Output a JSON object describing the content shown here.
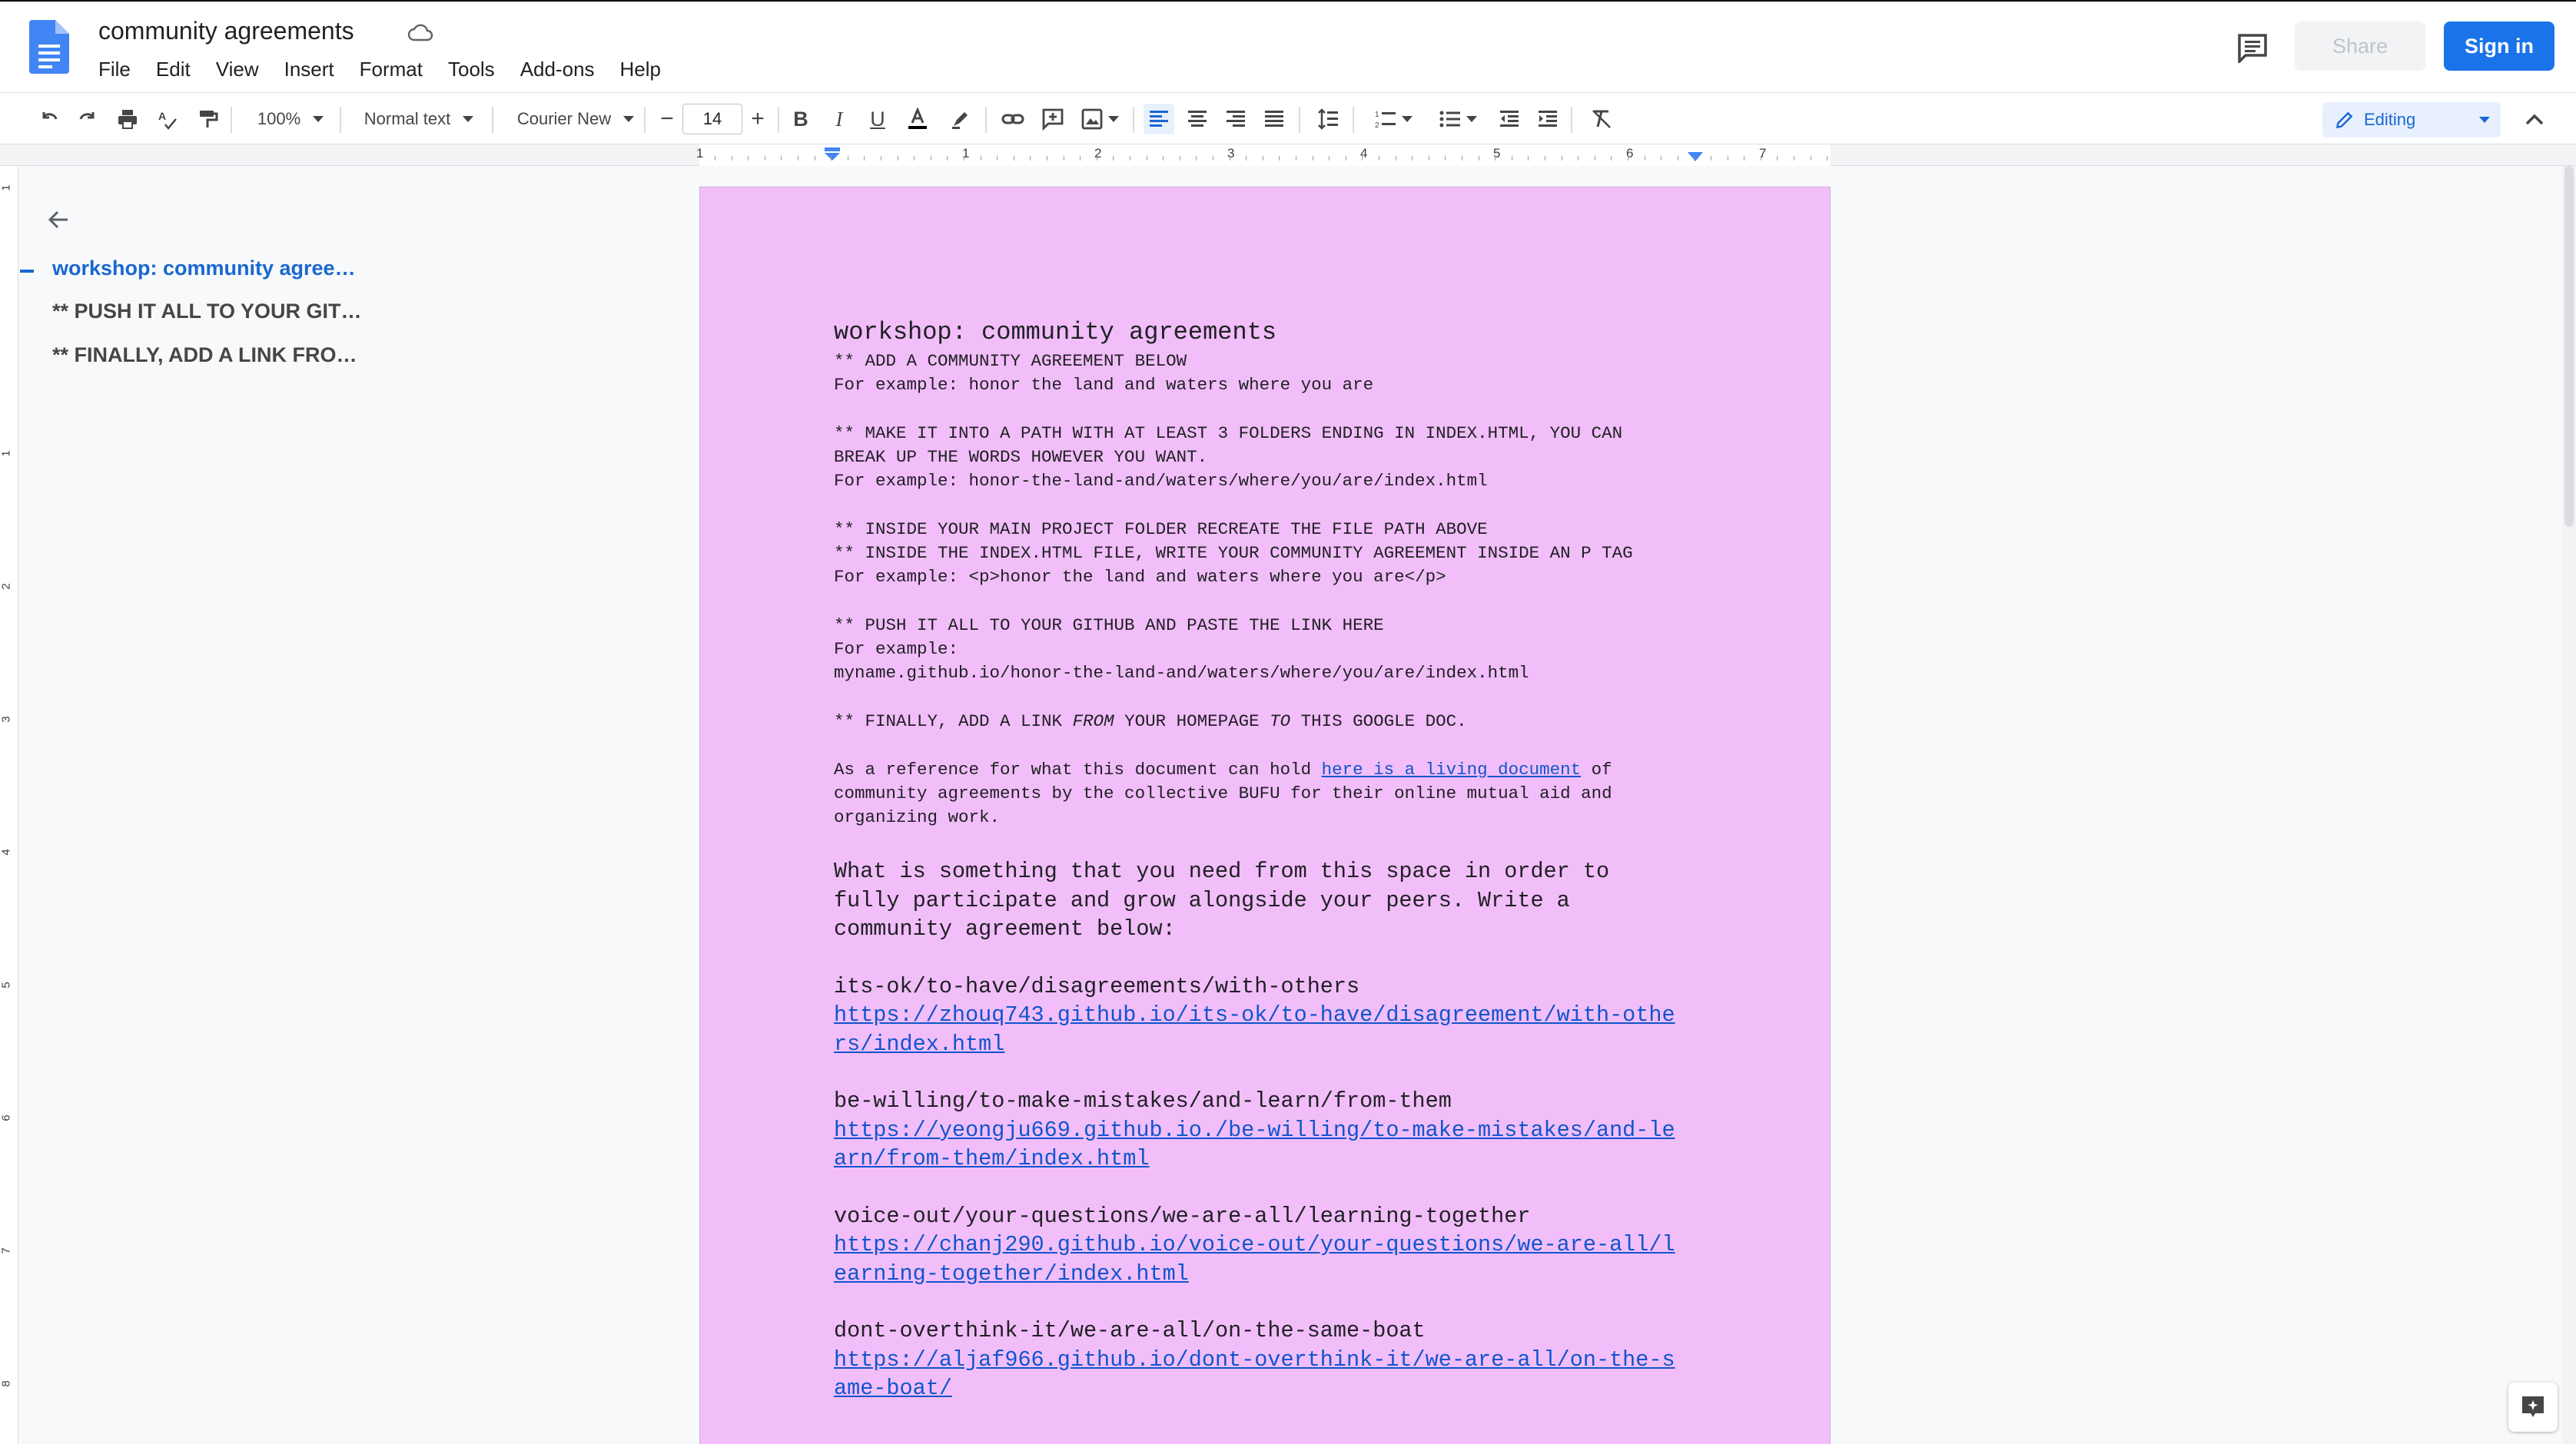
{
  "app": {
    "title": "community agreements",
    "menu": [
      "File",
      "Edit",
      "View",
      "Insert",
      "Format",
      "Tools",
      "Add-ons",
      "Help"
    ],
    "share_label": "Share",
    "signin_label": "Sign in"
  },
  "toolbar": {
    "zoom": "100%",
    "style": "Normal text",
    "font": "Courier New",
    "font_size": "14",
    "editing_mode": "Editing"
  },
  "ruler": {
    "numbers": [
      "1",
      "1",
      "2",
      "3",
      "4",
      "5",
      "6",
      "7"
    ],
    "vertical_numbers": [
      "1",
      "1",
      "2",
      "3",
      "4",
      "5",
      "6",
      "7",
      "8"
    ]
  },
  "outline": {
    "items": [
      "workshop: community agree…",
      "** PUSH IT ALL TO YOUR GIT…",
      "** FINALLY, ADD A LINK FRO…"
    ]
  },
  "colors": {
    "page_background": "#f2befa",
    "accent": "#1a73e8",
    "link": "#1155cc"
  },
  "doc": {
    "title": "workshop: community agreements",
    "p1": [
      "** ADD A COMMUNITY AGREEMENT BELOW",
      "For example: honor the land and waters where you are"
    ],
    "p2": [
      "** MAKE IT INTO A PATH WITH AT LEAST 3 FOLDERS ENDING IN INDEX.HTML, YOU CAN",
      "BREAK UP THE WORDS HOWEVER YOU WANT.",
      "For example: honor-the-land-and/waters/where/you/are/index.html"
    ],
    "p3": [
      "** INSIDE YOUR MAIN PROJECT FOLDER RECREATE THE FILE PATH ABOVE",
      "** INSIDE THE INDEX.HTML FILE, WRITE YOUR COMMUNITY AGREEMENT INSIDE AN P TAG",
      "For example: <p>honor the land and waters where you are</p>"
    ],
    "p4": [
      "** PUSH IT ALL TO YOUR GITHUB AND PASTE THE LINK HERE",
      "For example:",
      "myname.github.io/honor-the-land-and/waters/where/you/are/index.html"
    ],
    "p5": {
      "a": "** FINALLY, ADD A LINK ",
      "b": "FROM",
      "c": " YOUR HOMEPAGE ",
      "d": "TO",
      "e": " THIS GOOGLE DOC."
    },
    "p6": {
      "line1_a": "As a reference for what this document can hold ",
      "line1_link": "here is a living document",
      "line1_b": " of",
      "line2": "community agreements by the collective BUFU for their online mutual aid and",
      "line3": "organizing work."
    },
    "question": [
      "What is something that you need from this space in order to",
      "fully participate and grow alongside your peers. Write a",
      "community agreement below:"
    ],
    "entries": [
      {
        "path": "its-ok/to-have/disagreements/with-others",
        "link": [
          "https://zhouq743.github.io/its-ok/to-have/disagreement/with-othe",
          "rs/index.html"
        ]
      },
      {
        "path": "be-willing/to-make-mistakes/and-learn/from-them",
        "link": [
          "https://yeongju669.github.io./be-willing/to-make-mistakes/and-le",
          "arn/from-them/index.html"
        ]
      },
      {
        "path": "voice-out/your-questions/we-are-all/learning-together",
        "link": [
          "https://chanj290.github.io/voice-out/your-questions/we-are-all/l",
          "earning-together/index.html"
        ]
      },
      {
        "path": "dont-overthink-it/we-are-all/on-the-same-boat",
        "link": [
          "https://aljaf966.github.io/dont-overthink-it/we-are-all/on-the-s",
          "ame-boat/"
        ]
      }
    ]
  }
}
